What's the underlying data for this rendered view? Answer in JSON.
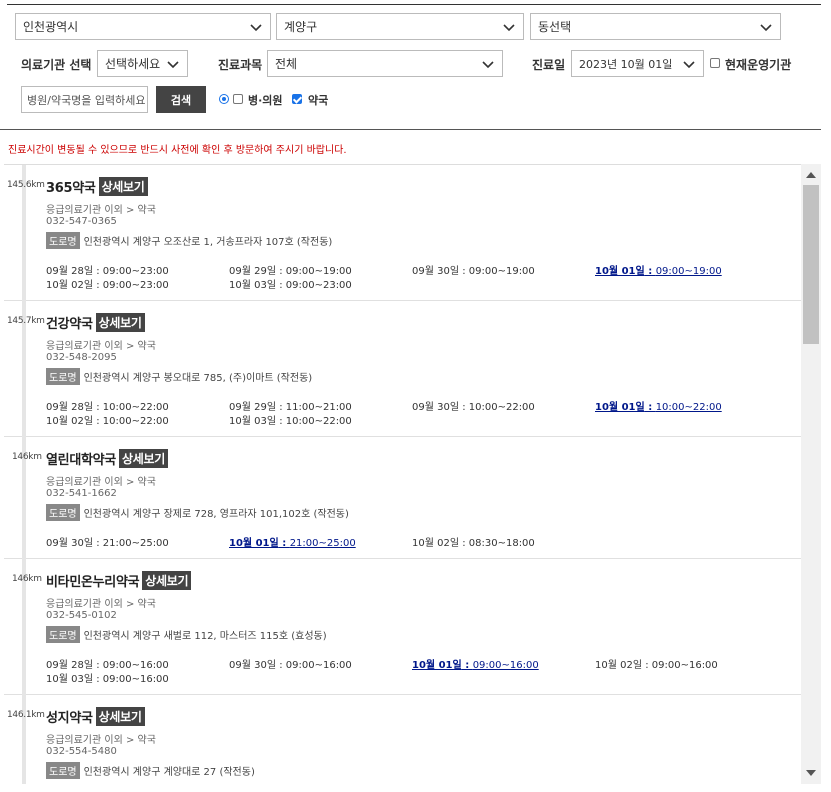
{
  "filters": {
    "city": "인천광역시",
    "district": "계양구",
    "dong": "동선택",
    "institution_label": "의료기관 선택",
    "institution_value": "선택하세요",
    "dept_label": "진료과목",
    "dept_value": "전체",
    "date_label": "진료일",
    "date_value": "2023년 10월 01일",
    "operating_label": "현재운영기관",
    "search_placeholder": "병원/약국명을 입력하세요",
    "search_button": "검색",
    "hospital_label": "병·의원",
    "pharmacy_label": "약국"
  },
  "notice": "진료시간이 변동될 수 있으므로 반드시 사전에 확인 후 방문하여 주시기 바랍니다.",
  "detail_label": "상세보기",
  "road_label": "도로명",
  "items": [
    {
      "distance": "145.6km",
      "name": "365약국",
      "category": "응급의료기관 이외 > 약국",
      "phone": "032-547-0365",
      "address": "인천광역시 계양구 오조산로 1, 거송프라자 107호 (작전동)",
      "hours": [
        {
          "day": "09월 28일",
          "time": "09:00~23:00",
          "today": false
        },
        {
          "day": "09월 29일",
          "time": "09:00~19:00",
          "today": false
        },
        {
          "day": "09월 30일",
          "time": "09:00~19:00",
          "today": false
        },
        {
          "day": "10월 01일",
          "time": "09:00~19:00",
          "today": true
        },
        {
          "day": "10월 02일",
          "time": "09:00~23:00",
          "today": false
        },
        {
          "day": "10월 03일",
          "time": "09:00~23:00",
          "today": false
        }
      ]
    },
    {
      "distance": "145.7km",
      "name": "건강약국",
      "category": "응급의료기관 이외 > 약국",
      "phone": "032-548-2095",
      "address": "인천광역시 계양구 봉오대로 785, (주)이마트 (작전동)",
      "hours": [
        {
          "day": "09월 28일",
          "time": "10:00~22:00",
          "today": false
        },
        {
          "day": "09월 29일",
          "time": "11:00~21:00",
          "today": false
        },
        {
          "day": "09월 30일",
          "time": "10:00~22:00",
          "today": false
        },
        {
          "day": "10월 01일",
          "time": "10:00~22:00",
          "today": true
        },
        {
          "day": "10월 02일",
          "time": "10:00~22:00",
          "today": false
        },
        {
          "day": "10월 03일",
          "time": "10:00~22:00",
          "today": false
        }
      ]
    },
    {
      "distance": "146km",
      "name": "열린대학약국",
      "category": "응급의료기관 이외 > 약국",
      "phone": "032-541-1662",
      "address": "인천광역시 계양구 장제로 728, 영프라자 101,102호 (작전동)",
      "hours": [
        {
          "day": "09월 30일",
          "time": "21:00~25:00",
          "today": false
        },
        {
          "day": "10월 01일",
          "time": "21:00~25:00",
          "today": true
        },
        {
          "day": "10월 02일",
          "time": "08:30~18:00",
          "today": false
        }
      ]
    },
    {
      "distance": "146km",
      "name": "비타민온누리약국",
      "category": "응급의료기관 이외 > 약국",
      "phone": "032-545-0102",
      "address": "인천광역시 계양구 새벌로 112, 마스터즈 115호 (효성동)",
      "hours": [
        {
          "day": "09월 28일",
          "time": "09:00~16:00",
          "today": false
        },
        {
          "day": "09월 30일",
          "time": "09:00~16:00",
          "today": false
        },
        {
          "day": "10월 01일",
          "time": "09:00~16:00",
          "today": true
        },
        {
          "day": "10월 02일",
          "time": "09:00~16:00",
          "today": false
        },
        {
          "day": "10월 03일",
          "time": "09:00~16:00",
          "today": false
        }
      ]
    },
    {
      "distance": "146.1km",
      "name": "성지약국",
      "category": "응급의료기관 이외 > 약국",
      "phone": "032-554-5480",
      "address": "인천광역시 계양구 계양대로 27 (작전동)",
      "hours": []
    }
  ]
}
